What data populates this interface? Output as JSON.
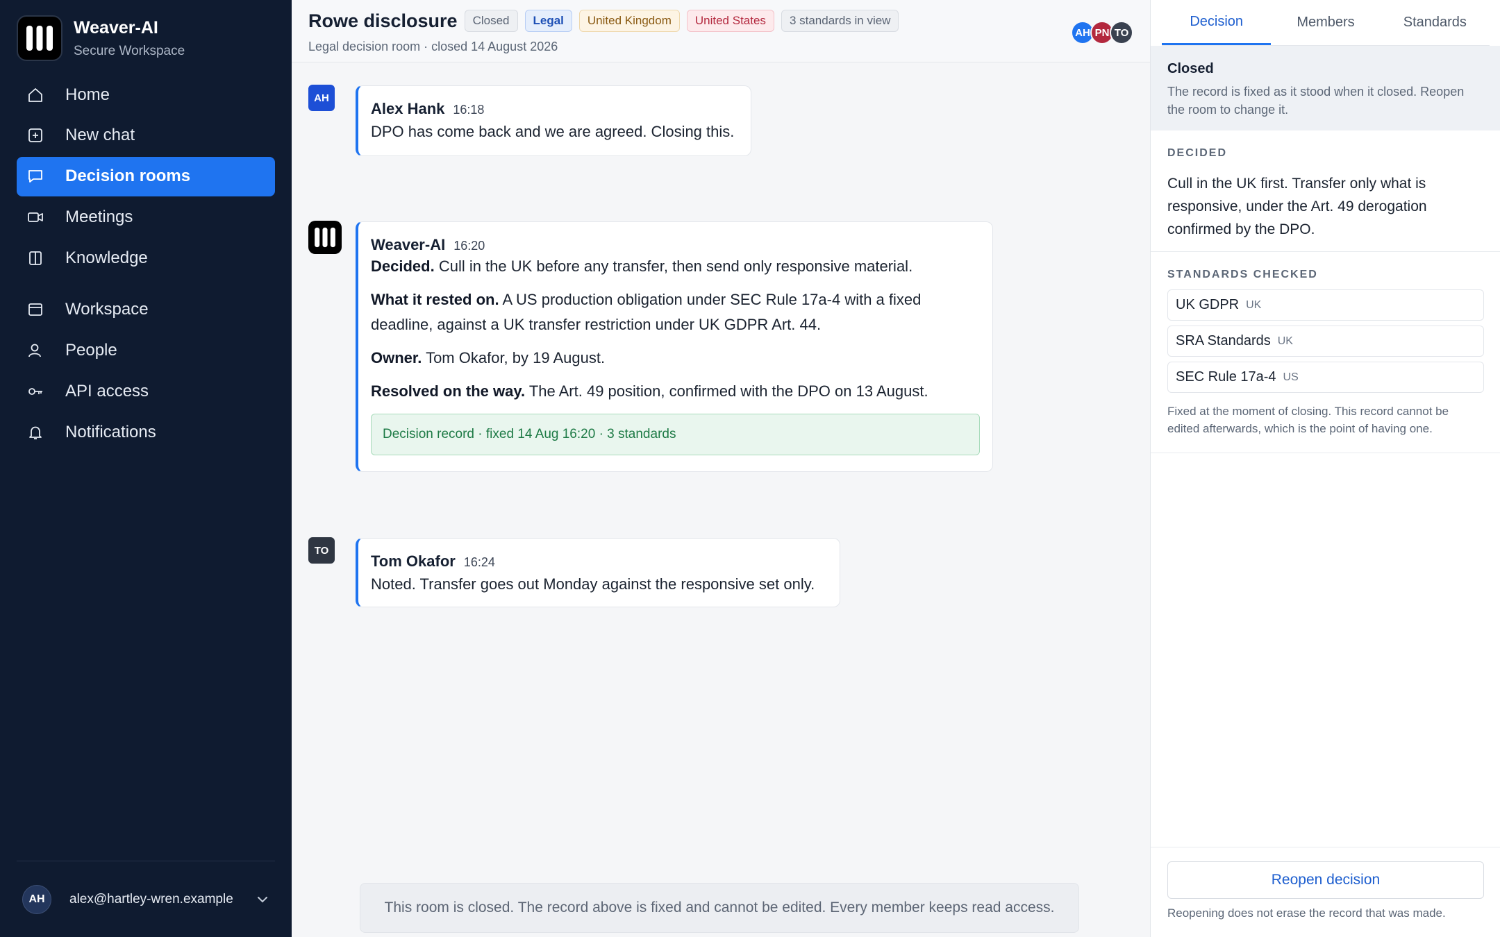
{
  "brand": {
    "name": "Weaver-AI",
    "subtitle": "Secure Workspace"
  },
  "sidebar": {
    "items": [
      {
        "label": "Home",
        "icon": "home-icon"
      },
      {
        "label": "New chat",
        "icon": "plus-square-icon"
      },
      {
        "label": "Decision rooms",
        "icon": "chat-bubble-icon",
        "active": true
      },
      {
        "label": "Meetings",
        "icon": "video-icon"
      },
      {
        "label": "Knowledge",
        "icon": "book-icon"
      },
      {
        "label": "Workspace",
        "icon": "window-icon"
      },
      {
        "label": "People",
        "icon": "person-icon"
      },
      {
        "label": "API access",
        "icon": "key-icon"
      },
      {
        "label": "Notifications",
        "icon": "bell-icon"
      }
    ],
    "user": {
      "initials": "AH",
      "email": "alex@hartley-wren.example"
    }
  },
  "header": {
    "title": "Rowe disclosure",
    "chips": [
      "Closed",
      "Legal",
      "United Kingdom",
      "United States",
      "3 standards in view"
    ],
    "subtitle": "Legal decision room · closed 14 August 2026",
    "members": [
      "AH",
      "PN",
      "TO"
    ]
  },
  "messages": [
    {
      "initials": "AH",
      "author": "Alex Hank",
      "time": "16:18",
      "text": "DPO has come back and we are agreed. Closing this."
    },
    {
      "author": "Weaver-AI",
      "time": "16:20",
      "paragraphs": [
        {
          "lead": "Decided.",
          "text": " Cull in the UK before any transfer, then send only responsive material."
        },
        {
          "lead": "What it rested on.",
          "text": " A US production obligation under SEC Rule 17a-4 with a fixed deadline, against a UK transfer restriction under UK GDPR Art. 44."
        },
        {
          "lead": "Owner.",
          "text": " Tom Okafor, by 19 August."
        },
        {
          "lead": "Resolved on the way.",
          "text": " The Art. 49 position, confirmed with the DPO on 13 August."
        }
      ],
      "record": "Decision record · fixed 14 Aug 16:20 · 3 standards"
    },
    {
      "initials": "TO",
      "author": "Tom Okafor",
      "time": "16:24",
      "text": "Noted. Transfer goes out Monday against the responsive set only."
    }
  ],
  "closed_notice": "This room is closed. The record above is fixed and cannot be edited. Every member keeps read access.",
  "panel": {
    "tabs": [
      "Decision",
      "Members",
      "Standards"
    ],
    "status_title": "Closed",
    "status_desc": "The record is fixed as it stood when it closed. Reopen the room to change it.",
    "decided_label": "DECIDED",
    "decided_text": "Cull in the UK first. Transfer only what is responsive, under the Art. 49 derogation confirmed by the DPO.",
    "standards_label": "STANDARDS CHECKED",
    "standards": [
      {
        "name": "UK GDPR",
        "juris": "UK"
      },
      {
        "name": "SRA Standards",
        "juris": "UK"
      },
      {
        "name": "SEC Rule 17a-4",
        "juris": "US"
      }
    ],
    "fixed_note": "Fixed at the moment of closing. This record cannot be edited afterwards, which is the point of having one.",
    "reopen_label": "Reopen decision",
    "reopen_note": "Reopening does not erase the record that was made."
  },
  "colors": {
    "accent": "#1f74f0",
    "sidebar_bg": "#0f1b30",
    "record_green": "#1d7a45"
  }
}
